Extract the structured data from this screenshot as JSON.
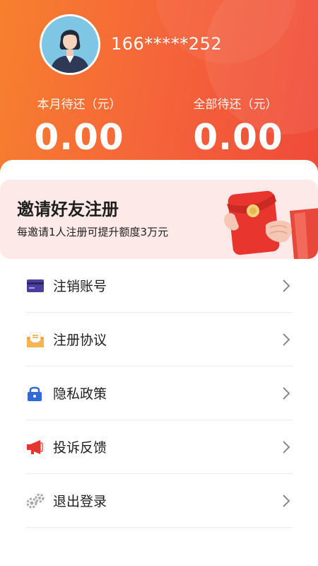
{
  "user": {
    "phone": "166*****252"
  },
  "stats": [
    {
      "label": "本月待还（元）",
      "value": "0.00"
    },
    {
      "label": "全部待还（元）",
      "value": "0.00"
    }
  ],
  "invite": {
    "title": "邀请好友注册",
    "subtitle": "每邀请1人注册可提升额度3万元"
  },
  "menu": {
    "items": [
      {
        "label": "注销账号",
        "icon": "card-icon"
      },
      {
        "label": "注册协议",
        "icon": "envelope-icon"
      },
      {
        "label": "隐私政策",
        "icon": "lock-icon"
      },
      {
        "label": "投诉反馈",
        "icon": "megaphone-icon"
      },
      {
        "label": "退出登录",
        "icon": "gears-icon"
      }
    ]
  },
  "colors": {
    "header_start": "#f7802e",
    "header_end": "#ef4a3a",
    "invite_bg": "#fde9e7"
  }
}
